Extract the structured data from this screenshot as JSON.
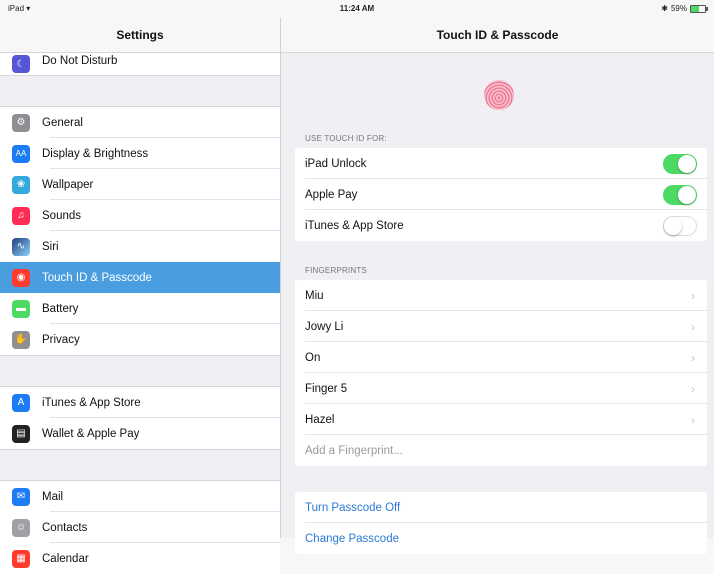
{
  "status_bar": {
    "device": "iPad",
    "time": "11:24 AM",
    "battery_text": "59%",
    "battery_level": 0.59
  },
  "sidebar": {
    "title": "Settings",
    "items": [
      {
        "label": "Do Not Disturb",
        "icon": "moon-icon",
        "color": "#5856d6"
      },
      {
        "label": "General",
        "icon": "gear-icon",
        "color": "#8e8e93"
      },
      {
        "label": "Display & Brightness",
        "icon": "text-size-icon",
        "color": "#1c7cf4"
      },
      {
        "label": "Wallpaper",
        "icon": "flower-icon",
        "color": "#34aadc"
      },
      {
        "label": "Sounds",
        "icon": "speaker-icon",
        "color": "#ff2d55"
      },
      {
        "label": "Siri",
        "icon": "siri-icon",
        "color": "#1f3c7a"
      },
      {
        "label": "Touch ID & Passcode",
        "icon": "fingerprint-icon",
        "color": "#ff3b30"
      },
      {
        "label": "Battery",
        "icon": "battery-icon",
        "color": "#4cd964"
      },
      {
        "label": "Privacy",
        "icon": "hand-icon",
        "color": "#8e8e93"
      },
      {
        "label": "iTunes & App Store",
        "icon": "app-store-icon",
        "color": "#1c7cf4"
      },
      {
        "label": "Wallet & Apple Pay",
        "icon": "wallet-icon",
        "color": "#222222"
      },
      {
        "label": "Mail",
        "icon": "mail-icon",
        "color": "#1c7cf4"
      },
      {
        "label": "Contacts",
        "icon": "contacts-icon",
        "color": "#a0a0a5"
      },
      {
        "label": "Calendar",
        "icon": "calendar-icon",
        "color": "#ff3b30"
      }
    ]
  },
  "main": {
    "title": "Touch ID & Passcode",
    "touch_id_section": "USE TOUCH ID FOR:",
    "touch_id_rows": [
      {
        "label": "iPad Unlock",
        "on": true
      },
      {
        "label": "Apple Pay",
        "on": true
      },
      {
        "label": "iTunes & App Store",
        "on": false
      }
    ],
    "fingerprints_section": "FINGERPRINTS",
    "fingerprints": [
      "Miu",
      "Jowy Li",
      "On",
      "Finger 5",
      "Hazel"
    ],
    "add_fingerprint": "Add a Fingerprint...",
    "passcode_actions": [
      "Turn Passcode Off",
      "Change Passcode"
    ]
  },
  "colors": {
    "accent": "#4a9ee0",
    "toggle_on": "#4cd964",
    "link": "#2a7bd6"
  }
}
